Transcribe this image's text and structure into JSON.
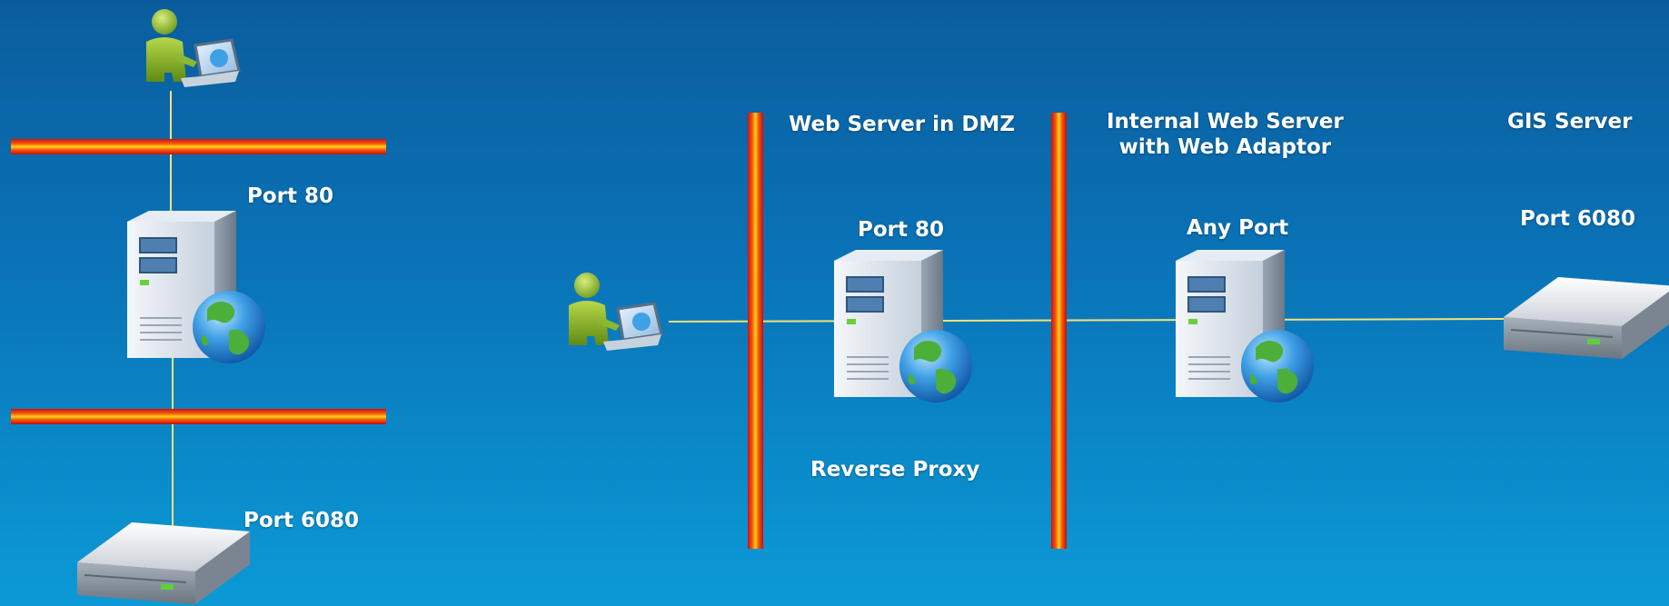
{
  "left_scenario": {
    "port_web": "Port 80",
    "port_gis": "Port 6080"
  },
  "right_scenario": {
    "web_server_dmz": "Web Server in DMZ",
    "web_server_port": "Port 80",
    "reverse_proxy": "Reverse Proxy",
    "internal_server_line1": "Internal Web Server",
    "internal_server_line2": "with Web Adaptor",
    "internal_server_port": "Any Port",
    "gis_server": "GIS Server",
    "gis_port": "Port 6080"
  },
  "icons": {
    "user": "user-laptop-icon",
    "web_server": "server-tower-globe-icon",
    "gis_server": "rack-server-icon",
    "firewall": "firewall-bar"
  },
  "colors": {
    "background_top": "#0a5d9d",
    "background_bottom": "#0b9ad6",
    "connector": "#f3e27a",
    "firewall_red": "#d01010",
    "firewall_yellow": "#ffd21a",
    "text": "#ffffff"
  }
}
